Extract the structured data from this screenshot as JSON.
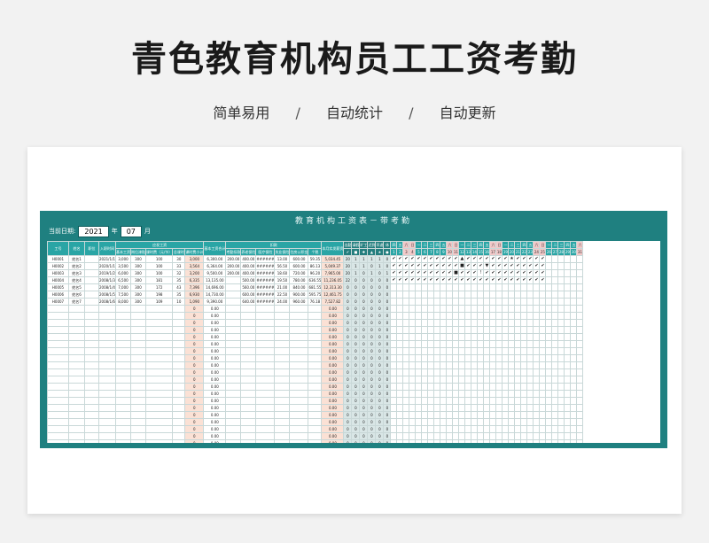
{
  "page": {
    "title": "青色教育机构员工工资考勤",
    "features": [
      "简单易用",
      "自动统计",
      "自动更新"
    ],
    "separator": "/"
  },
  "sheet": {
    "title": "教育机构工资表－带考勤",
    "date_label": "当前日期:",
    "year": "2021",
    "year_unit": "年",
    "month": "07",
    "month_unit": "月"
  },
  "table": {
    "headers": {
      "id": "工号",
      "name": "姓名",
      "position": "职位",
      "hire": "入职时间",
      "payable_group": "应发工资",
      "basic": "基本工资",
      "allowance": "岗位津贴",
      "hour_rate": "课时费（元/节）",
      "lessons": "总课时",
      "lesson_fee": "课时费小计",
      "base_total": "基本工资合计",
      "deduct_group": "扣款",
      "attendance": "考勤扣款",
      "pension": "养老保险",
      "medical": "医疗保险",
      "unemploy": "失业保险",
      "fund": "住房公积金",
      "tax": "个税",
      "net": "本月实发薪资"
    },
    "att_summary_headers": [
      "出勤",
      "请假",
      "旷工",
      "迟到",
      "早退",
      "休"
    ],
    "att_summary_icons": [
      "✔",
      "■",
      "✚",
      "▲",
      "★",
      "●"
    ],
    "weekdays": [
      "四",
      "五",
      "六",
      "日",
      "一",
      "二",
      "三",
      "四",
      "五",
      "六",
      "日",
      "一",
      "二",
      "三",
      "四",
      "五",
      "六",
      "日",
      "一",
      "二",
      "三",
      "四",
      "五",
      "六",
      "日",
      "一",
      "二",
      "三",
      "四",
      "五",
      "六"
    ],
    "days": [
      "1",
      "2",
      "3",
      "4",
      "5",
      "6",
      "7",
      "8",
      "9",
      "10",
      "11",
      "12",
      "13",
      "14",
      "15",
      "16",
      "17",
      "18",
      "19",
      "20",
      "21",
      "22",
      "23",
      "24",
      "25",
      "26",
      "27",
      "28",
      "29",
      "30",
      "31"
    ],
    "rows": [
      {
        "id": "H0001",
        "name": "姓名1",
        "hire": "2021/1/1",
        "basic": "3,000",
        "allowance": "300",
        "rate": "100",
        "lessons": "30",
        "fee": "3,000",
        "total": "6,300.00",
        "att": "200.00",
        "pension": "400.00",
        "med": "######",
        "unemp": "13.00",
        "fund": "600.00",
        "tax": "59.35",
        "net": "5,034.45",
        "s": [
          "20",
          "1",
          "1",
          "1",
          "1",
          "0"
        ],
        "marks": "✔✔ ✔✔✔✔✔ ✔✔✔ ✔▲✔✔✔ ✔✔✔✔★ ✔✔✔✔✔"
      },
      {
        "id": "H0002",
        "name": "姓名2",
        "hire": "2020/1/1",
        "basic": "3,500",
        "allowance": "300",
        "rate": "100",
        "lessons": "33",
        "fee": "3,564",
        "total": "6,364.00",
        "att": "200.00",
        "pension": "400.00",
        "med": "######",
        "unemp": "56.50",
        "fund": "600.00",
        "tax": "86.13",
        "net": "5,049.37",
        "s": [
          "20",
          "1",
          "1",
          "0",
          "1",
          "0"
        ],
        "marks": "✔✔ ✔✔✔✔✔ ✔✔✔ ✔■✔✔✔ ▼✔✔✔✔ ✔✔✔✔✔"
      },
      {
        "id": "H0003",
        "name": "姓名3",
        "hire": "2019/1/2",
        "basic": "6,000",
        "allowance": "300",
        "rate": "100",
        "lessons": "32",
        "fee": "3,200",
        "total": "9,500.00",
        "att": "200.00",
        "pension": "400.00",
        "med": "######",
        "unemp": "18.60",
        "fund": "720.00",
        "tax": "96.20",
        "net": "7,965.00",
        "s": [
          "20",
          "1",
          "0",
          "1",
          "0",
          "1"
        ],
        "marks": "✔✔ ✔✔✔✔✔ ✔✔✔ ■✔✔✔! ✔✔✔✔✔ ✔✔✔✔✔"
      },
      {
        "id": "H0004",
        "name": "姓名4",
        "hire": "2008/1/3",
        "basic": "6,500",
        "allowance": "300",
        "rate": "181",
        "lessons": "35",
        "fee": "6,335",
        "total": "13,135.00",
        "att": "",
        "pension": "500.00",
        "med": "######",
        "unemp": "19.50",
        "fund": "780.00",
        "tax": "636.55",
        "net": "11,236.05",
        "s": [
          "22",
          "0",
          "0",
          "0",
          "0",
          "0"
        ],
        "marks": "✔✔ ✔✔✔✔✔ ✔✔✔ ✔✔✔✔✔ ✔✔✔✔✔ ✔✔✔✔✔"
      },
      {
        "id": "H0005",
        "name": "姓名5",
        "hire": "2008/1/4",
        "basic": "7,000",
        "allowance": "300",
        "rate": "172",
        "lessons": "43",
        "fee": "7,396",
        "total": "14,696.00",
        "att": "",
        "pension": "560.00",
        "med": "######",
        "unemp": "21.00",
        "fund": "840.00",
        "tax": "681.55",
        "net": "12,313.30",
        "s": [
          "0",
          "0",
          "0",
          "0",
          "0",
          "0"
        ],
        "marks": ""
      },
      {
        "id": "H0006",
        "name": "姓名6",
        "hire": "2008/1/5",
        "basic": "7,500",
        "allowance": "300",
        "rate": "198",
        "lessons": "35",
        "fee": "6,930",
        "total": "14,730.00",
        "att": "",
        "pension": "600.00",
        "med": "######",
        "unemp": "22.50",
        "fund": "900.00",
        "tax": "595.75",
        "net": "12,461.75",
        "s": [
          "0",
          "0",
          "0",
          "0",
          "0",
          "0"
        ],
        "marks": ""
      },
      {
        "id": "H0007",
        "name": "姓名7",
        "hire": "2008/1/6",
        "basic": "8,000",
        "allowance": "300",
        "rate": "109",
        "lessons": "10",
        "fee": "1,090",
        "total": "9,390.00",
        "att": "",
        "pension": "640.00",
        "med": "######",
        "unemp": "24.00",
        "fund": "960.00",
        "tax": "76.18",
        "net": "7,527.82",
        "s": [
          "0",
          "0",
          "0",
          "0",
          "0",
          "0"
        ],
        "marks": ""
      }
    ],
    "empty_fee": "0",
    "empty_total": "0.00",
    "empty_net": "0.00",
    "empty_s": "0"
  }
}
